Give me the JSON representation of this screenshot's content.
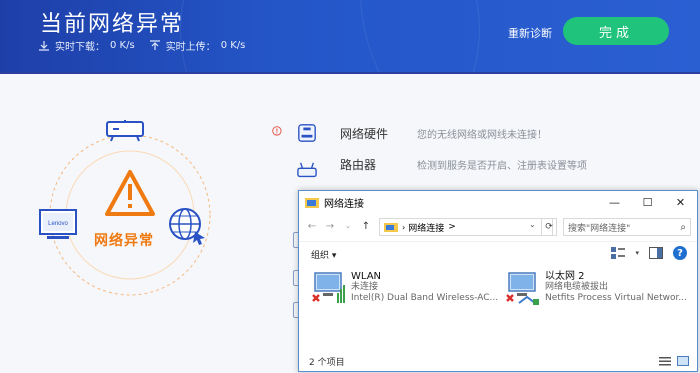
{
  "header": {
    "title": "当前网络异常",
    "download_label": "实时下载：",
    "download_value": "0 K/s",
    "upload_label": "实时上传：",
    "upload_value": "0 K/s",
    "rediagnose": "重新诊断",
    "done": "完成"
  },
  "diagram": {
    "center_label": "网络异常",
    "laptop_brand": "Lenovo"
  },
  "rows": [
    {
      "name": "网络硬件",
      "desc": "您的无线网络或网线未连接！",
      "status": "error"
    },
    {
      "name": "路由器",
      "desc": "检测到服务是否开启、注册表设置等项",
      "status": "pending"
    }
  ],
  "window": {
    "title": "网络连接",
    "controls": {
      "minimize": "—",
      "maximize": "☐",
      "close": "✕"
    },
    "address": "网络连接",
    "address_sep": ">",
    "search_placeholder": "搜索\"网络连接\"",
    "organize": "组织 ▾",
    "items": [
      {
        "name": "WLAN",
        "status": "未连接",
        "device": "Intel(R) Dual Band Wireless-AC..."
      },
      {
        "name": "以太网 2",
        "status": "网络电缆被拔出",
        "device": "Netfits Process Virtual Networ..."
      }
    ],
    "status_count": "2 个项目"
  },
  "colors": {
    "header_bg": "#2456c8",
    "done_button": "#1fc37b",
    "warning": "#f07a12",
    "error_red": "#e24b3c"
  }
}
